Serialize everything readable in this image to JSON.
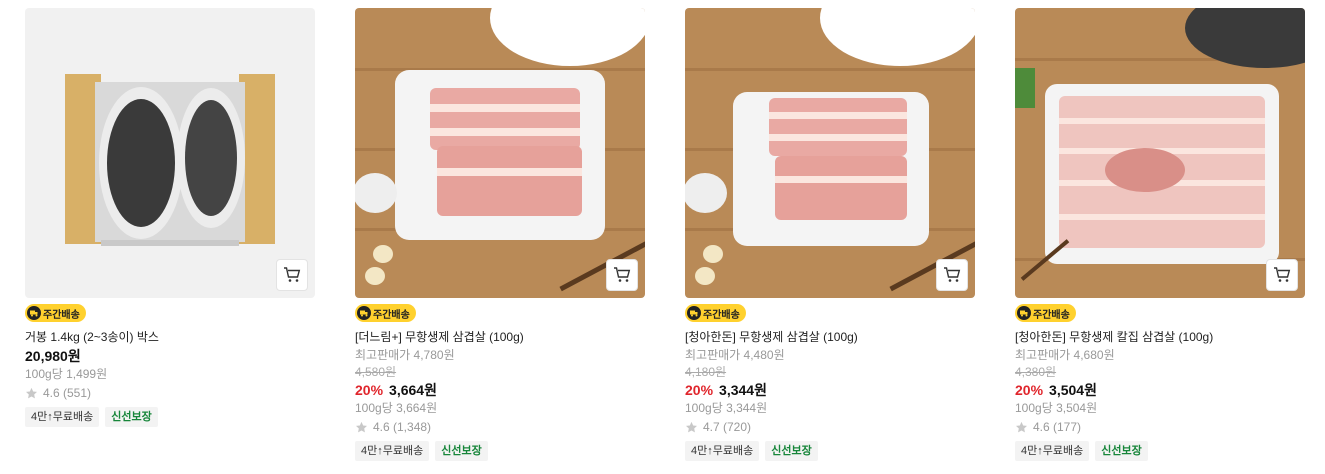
{
  "colors": {
    "discount": "#e0252c",
    "badge": "#ffd12e",
    "fresh": "#17863a"
  },
  "products": [
    {
      "badge": "주간배송",
      "name": "거봉 1.4kg (2~3송이) 박스",
      "price": "20,980원",
      "unit_price": "100g당 1,499원",
      "rating": "4.6 (551)",
      "tags": [
        "4만↑무료배송",
        "신선보장"
      ]
    },
    {
      "badge": "주간배송",
      "name": "[더느림+] 무항생제 삼겹살 (100g)",
      "highest_price": "최고판매가 4,780원",
      "original_price": "4,580원",
      "discount": "20%",
      "price": "3,664원",
      "unit_price": "100g당 3,664원",
      "rating": "4.6 (1,348)",
      "tags": [
        "4만↑무료배송",
        "신선보장"
      ]
    },
    {
      "badge": "주간배송",
      "name": "[청아한돈] 무항생제 삼겹살 (100g)",
      "highest_price": "최고판매가 4,480원",
      "original_price": "4,180원",
      "discount": "20%",
      "price": "3,344원",
      "unit_price": "100g당 3,344원",
      "rating": "4.7 (720)",
      "tags": [
        "4만↑무료배송",
        "신선보장"
      ]
    },
    {
      "badge": "주간배송",
      "name": "[청아한돈] 무항생제 칼집 삼겹살 (100g)",
      "highest_price": "최고판매가 4,680원",
      "original_price": "4,380원",
      "discount": "20%",
      "price": "3,504원",
      "unit_price": "100g당 3,504원",
      "rating": "4.6 (177)",
      "tags": [
        "4만↑무료배송",
        "신선보장"
      ]
    }
  ]
}
